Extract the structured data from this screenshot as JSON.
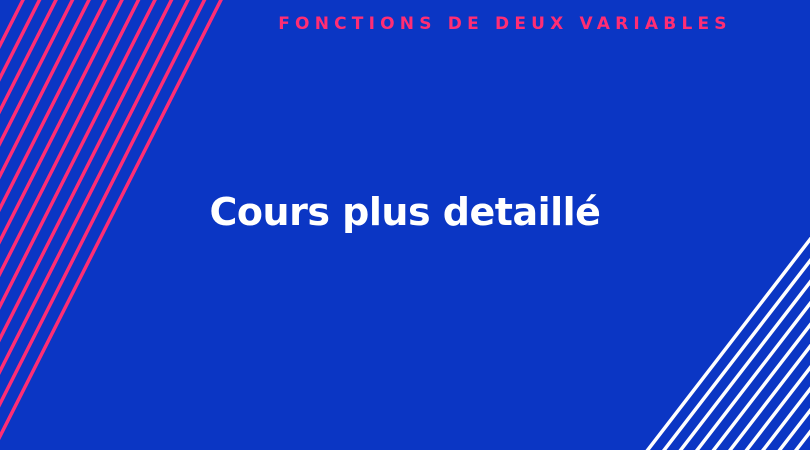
{
  "banner": {
    "subject": "FONCTIONS DE DEUX VARIABLES",
    "title": "Cours plus detaillé"
  },
  "colors": {
    "background": "#0b36c4",
    "accent": "#ff2d74",
    "text": "#ffffff"
  }
}
